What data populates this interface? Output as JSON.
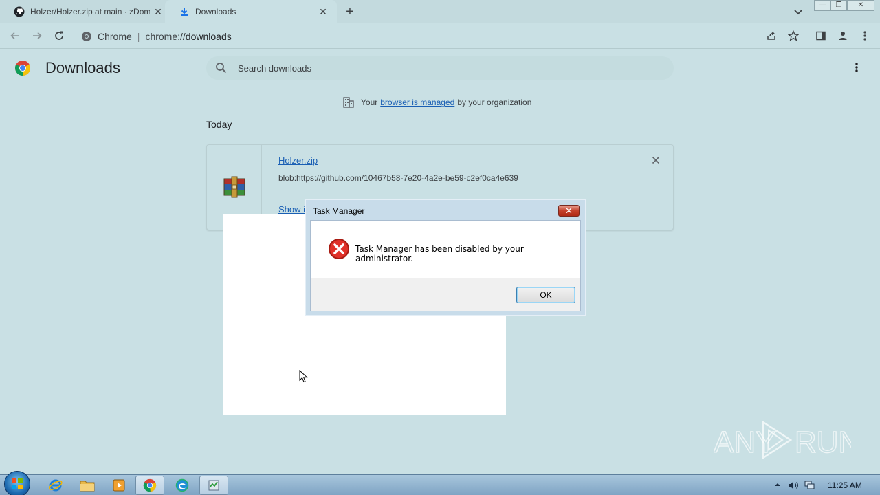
{
  "browser": {
    "tabs": [
      {
        "title": "Holzer/Holzer.zip at main · zDom",
        "icon": "github-icon"
      },
      {
        "title": "Downloads",
        "icon": "download-icon"
      }
    ],
    "omnibox": {
      "site_label": "Chrome",
      "url_scheme": "chrome://",
      "url_host": "downloads"
    }
  },
  "page": {
    "title": "Downloads",
    "search_placeholder": "Search downloads",
    "managed_notice": {
      "prefix": "Your",
      "link": "browser is managed",
      "suffix": "by your organization"
    },
    "section_label": "Today",
    "download_item": {
      "file_name": "Holzer.zip",
      "source_url": "blob:https://github.com/10467b58-7e20-4a2e-be59-c2ef0ca4e639",
      "action_link": "Show i"
    }
  },
  "dialog": {
    "title": "Task Manager",
    "message": "Task Manager has been disabled by your administrator.",
    "ok_label": "OK",
    "icon": "error-icon"
  },
  "taskbar": {
    "apps": [
      "internet-explorer-icon",
      "file-explorer-icon",
      "media-player-icon",
      "chrome-icon",
      "edge-icon",
      "task-app-icon"
    ],
    "active_apps": [
      "chrome-icon",
      "task-app-icon"
    ],
    "clock": "11:25 AM"
  },
  "watermark": {
    "text_left": "ANY",
    "text_right": "RUN"
  },
  "colors": {
    "accent_link": "#1a5fb4",
    "background": "#c9e0e4",
    "dialog_close": "#c4412c"
  }
}
